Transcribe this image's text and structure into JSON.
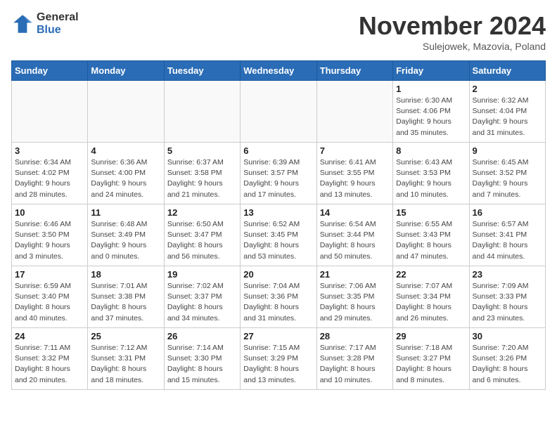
{
  "header": {
    "logo_general": "General",
    "logo_blue": "Blue",
    "month_title": "November 2024",
    "subtitle": "Sulejowek, Mazovia, Poland"
  },
  "days_of_week": [
    "Sunday",
    "Monday",
    "Tuesday",
    "Wednesday",
    "Thursday",
    "Friday",
    "Saturday"
  ],
  "weeks": [
    [
      {
        "day": "",
        "info": ""
      },
      {
        "day": "",
        "info": ""
      },
      {
        "day": "",
        "info": ""
      },
      {
        "day": "",
        "info": ""
      },
      {
        "day": "",
        "info": ""
      },
      {
        "day": "1",
        "info": "Sunrise: 6:30 AM\nSunset: 4:06 PM\nDaylight: 9 hours\nand 35 minutes."
      },
      {
        "day": "2",
        "info": "Sunrise: 6:32 AM\nSunset: 4:04 PM\nDaylight: 9 hours\nand 31 minutes."
      }
    ],
    [
      {
        "day": "3",
        "info": "Sunrise: 6:34 AM\nSunset: 4:02 PM\nDaylight: 9 hours\nand 28 minutes."
      },
      {
        "day": "4",
        "info": "Sunrise: 6:36 AM\nSunset: 4:00 PM\nDaylight: 9 hours\nand 24 minutes."
      },
      {
        "day": "5",
        "info": "Sunrise: 6:37 AM\nSunset: 3:58 PM\nDaylight: 9 hours\nand 21 minutes."
      },
      {
        "day": "6",
        "info": "Sunrise: 6:39 AM\nSunset: 3:57 PM\nDaylight: 9 hours\nand 17 minutes."
      },
      {
        "day": "7",
        "info": "Sunrise: 6:41 AM\nSunset: 3:55 PM\nDaylight: 9 hours\nand 13 minutes."
      },
      {
        "day": "8",
        "info": "Sunrise: 6:43 AM\nSunset: 3:53 PM\nDaylight: 9 hours\nand 10 minutes."
      },
      {
        "day": "9",
        "info": "Sunrise: 6:45 AM\nSunset: 3:52 PM\nDaylight: 9 hours\nand 7 minutes."
      }
    ],
    [
      {
        "day": "10",
        "info": "Sunrise: 6:46 AM\nSunset: 3:50 PM\nDaylight: 9 hours\nand 3 minutes."
      },
      {
        "day": "11",
        "info": "Sunrise: 6:48 AM\nSunset: 3:49 PM\nDaylight: 9 hours\nand 0 minutes."
      },
      {
        "day": "12",
        "info": "Sunrise: 6:50 AM\nSunset: 3:47 PM\nDaylight: 8 hours\nand 56 minutes."
      },
      {
        "day": "13",
        "info": "Sunrise: 6:52 AM\nSunset: 3:45 PM\nDaylight: 8 hours\nand 53 minutes."
      },
      {
        "day": "14",
        "info": "Sunrise: 6:54 AM\nSunset: 3:44 PM\nDaylight: 8 hours\nand 50 minutes."
      },
      {
        "day": "15",
        "info": "Sunrise: 6:55 AM\nSunset: 3:43 PM\nDaylight: 8 hours\nand 47 minutes."
      },
      {
        "day": "16",
        "info": "Sunrise: 6:57 AM\nSunset: 3:41 PM\nDaylight: 8 hours\nand 44 minutes."
      }
    ],
    [
      {
        "day": "17",
        "info": "Sunrise: 6:59 AM\nSunset: 3:40 PM\nDaylight: 8 hours\nand 40 minutes."
      },
      {
        "day": "18",
        "info": "Sunrise: 7:01 AM\nSunset: 3:38 PM\nDaylight: 8 hours\nand 37 minutes."
      },
      {
        "day": "19",
        "info": "Sunrise: 7:02 AM\nSunset: 3:37 PM\nDaylight: 8 hours\nand 34 minutes."
      },
      {
        "day": "20",
        "info": "Sunrise: 7:04 AM\nSunset: 3:36 PM\nDaylight: 8 hours\nand 31 minutes."
      },
      {
        "day": "21",
        "info": "Sunrise: 7:06 AM\nSunset: 3:35 PM\nDaylight: 8 hours\nand 29 minutes."
      },
      {
        "day": "22",
        "info": "Sunrise: 7:07 AM\nSunset: 3:34 PM\nDaylight: 8 hours\nand 26 minutes."
      },
      {
        "day": "23",
        "info": "Sunrise: 7:09 AM\nSunset: 3:33 PM\nDaylight: 8 hours\nand 23 minutes."
      }
    ],
    [
      {
        "day": "24",
        "info": "Sunrise: 7:11 AM\nSunset: 3:32 PM\nDaylight: 8 hours\nand 20 minutes."
      },
      {
        "day": "25",
        "info": "Sunrise: 7:12 AM\nSunset: 3:31 PM\nDaylight: 8 hours\nand 18 minutes."
      },
      {
        "day": "26",
        "info": "Sunrise: 7:14 AM\nSunset: 3:30 PM\nDaylight: 8 hours\nand 15 minutes."
      },
      {
        "day": "27",
        "info": "Sunrise: 7:15 AM\nSunset: 3:29 PM\nDaylight: 8 hours\nand 13 minutes."
      },
      {
        "day": "28",
        "info": "Sunrise: 7:17 AM\nSunset: 3:28 PM\nDaylight: 8 hours\nand 10 minutes."
      },
      {
        "day": "29",
        "info": "Sunrise: 7:18 AM\nSunset: 3:27 PM\nDaylight: 8 hours\nand 8 minutes."
      },
      {
        "day": "30",
        "info": "Sunrise: 7:20 AM\nSunset: 3:26 PM\nDaylight: 8 hours\nand 6 minutes."
      }
    ]
  ]
}
